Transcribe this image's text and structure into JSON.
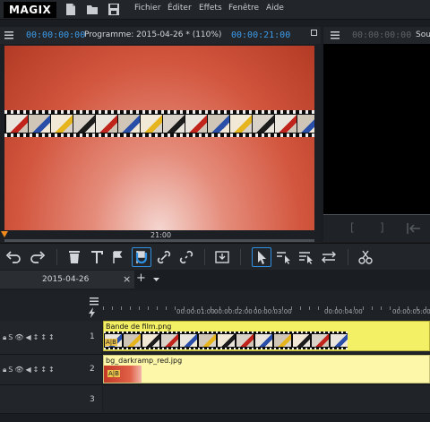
{
  "app": {
    "logo": "MAGIX",
    "menu": [
      "Fichier",
      "Éditer",
      "Effets",
      "Fenêtre",
      "Aide"
    ]
  },
  "program_monitor": {
    "timecode_left": "00:00:00:00",
    "title": "Programme: 2015-04-26 *  (110%)",
    "timecode_right": "00:00:21:00",
    "ruler_label": "21:00"
  },
  "source_monitor": {
    "timecode": "00:00:00:00",
    "title": "Sou"
  },
  "transport": {
    "mark_in": "[",
    "mark_out": "]"
  },
  "source_transport": {
    "mark_in": "[",
    "mark_out": "]"
  },
  "timeline": {
    "project_tab": "2015-04-26",
    "close_label": "×",
    "add_label": "+",
    "ruler_marks": [
      "00:00:01:00",
      "00:00:02:00",
      "00:00:03:00",
      "00:00:04:00",
      "00:00:05:00"
    ],
    "tracks": [
      {
        "number": "1",
        "clip_name": "Bande de film.png"
      },
      {
        "number": "2",
        "clip_name": "bg_darkramp_red.jpg"
      },
      {
        "number": "3",
        "clip_name": ""
      }
    ],
    "ab_badge": "A|B"
  },
  "colors": {
    "accent": "#2f8fe0",
    "clip_yellow": "#f4f066",
    "clip_yellow_light": "#fdf7a9",
    "timecode_blue": "#3d9ae8"
  }
}
